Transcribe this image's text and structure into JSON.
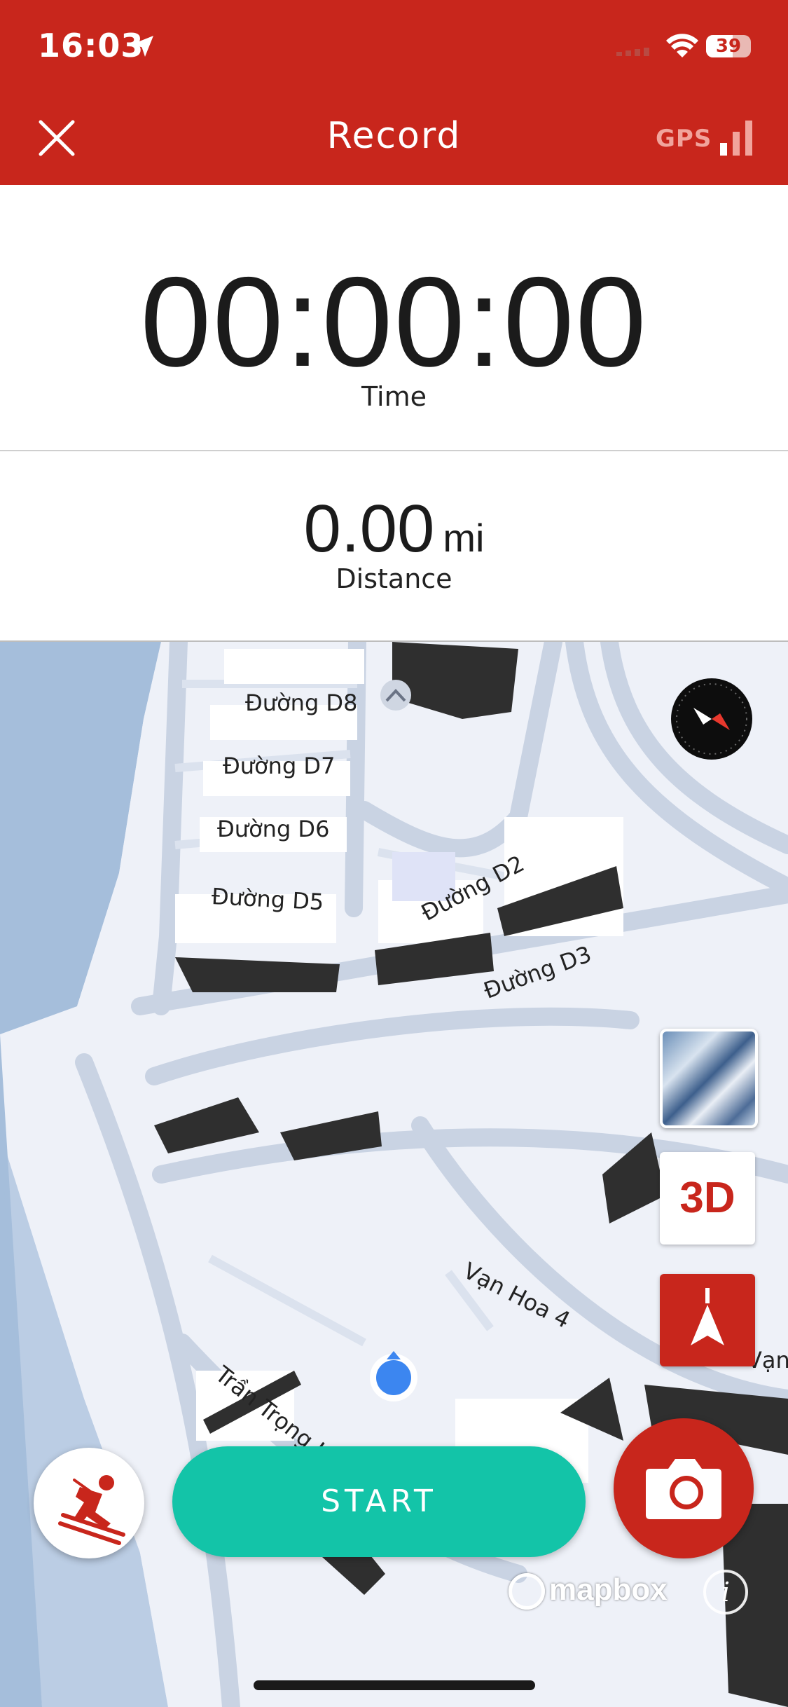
{
  "status_bar": {
    "time": "16:03",
    "battery": "39"
  },
  "header": {
    "title": "Record",
    "gps_label": "GPS"
  },
  "timer": {
    "value": "00:00:00",
    "label": "Time"
  },
  "distance": {
    "value": "0.00",
    "unit": "mi",
    "label": "Distance"
  },
  "map": {
    "streets": [
      "Đường D8",
      "Đường D7",
      "Đường D6",
      "Đường D5",
      "Đường D2",
      "Đường D3",
      "Vạn Hoa 4",
      "Trần Trọng K",
      "Vạn"
    ],
    "layer_button": "3D",
    "attribution": "mapbox",
    "info": "i"
  },
  "actions": {
    "start_label": "START"
  },
  "colors": {
    "brand_red": "#c8261c",
    "start_teal": "#13c4a8",
    "location_blue": "#3c86f0"
  },
  "icons": [
    "location-arrow-icon",
    "cellular-signal-icon",
    "wifi-icon",
    "battery-icon",
    "close-icon",
    "gps-signal-icon",
    "compass-icon",
    "map-layer-thumbnail",
    "navigation-arrow-icon",
    "skier-icon",
    "camera-icon",
    "mapbox-logo-icon",
    "info-icon"
  ]
}
